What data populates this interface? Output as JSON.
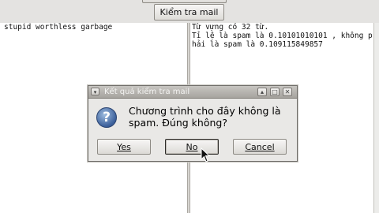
{
  "toolbar": {
    "check_mail_label": "Kiểm tra mail"
  },
  "left_pane": {
    "text": "stupid worthless garbage"
  },
  "right_pane": {
    "lines": [
      "Từ vựng có 32 từ.",
      "Tỉ lệ là spam là 0.10101010101 , không p",
      "hải là spam là 0.109115849857"
    ]
  },
  "dialog": {
    "title": "Kết quả kiểm tra mail",
    "message_line1": "Chương trình cho đây không là",
    "message_line2": "spam. Đúng không?",
    "yes_label": "Yes",
    "no_label": "No",
    "cancel_label": "Cancel",
    "icon": "question-icon"
  }
}
